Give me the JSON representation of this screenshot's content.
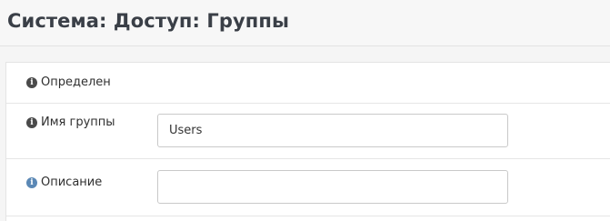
{
  "header": {
    "title": "Система: Доступ: Группы"
  },
  "form": {
    "rows": [
      {
        "label": "Определен",
        "icon": "info-icon"
      },
      {
        "label": "Имя группы",
        "icon": "info-icon",
        "value": "Users",
        "placeholder": ""
      },
      {
        "label": "Описание",
        "icon": "info-icon",
        "value": "",
        "placeholder": ""
      }
    ]
  },
  "colors": {
    "title": "#3a3f47",
    "icon_dark": "#4a4a4a",
    "icon_blue": "#5b88b5"
  }
}
